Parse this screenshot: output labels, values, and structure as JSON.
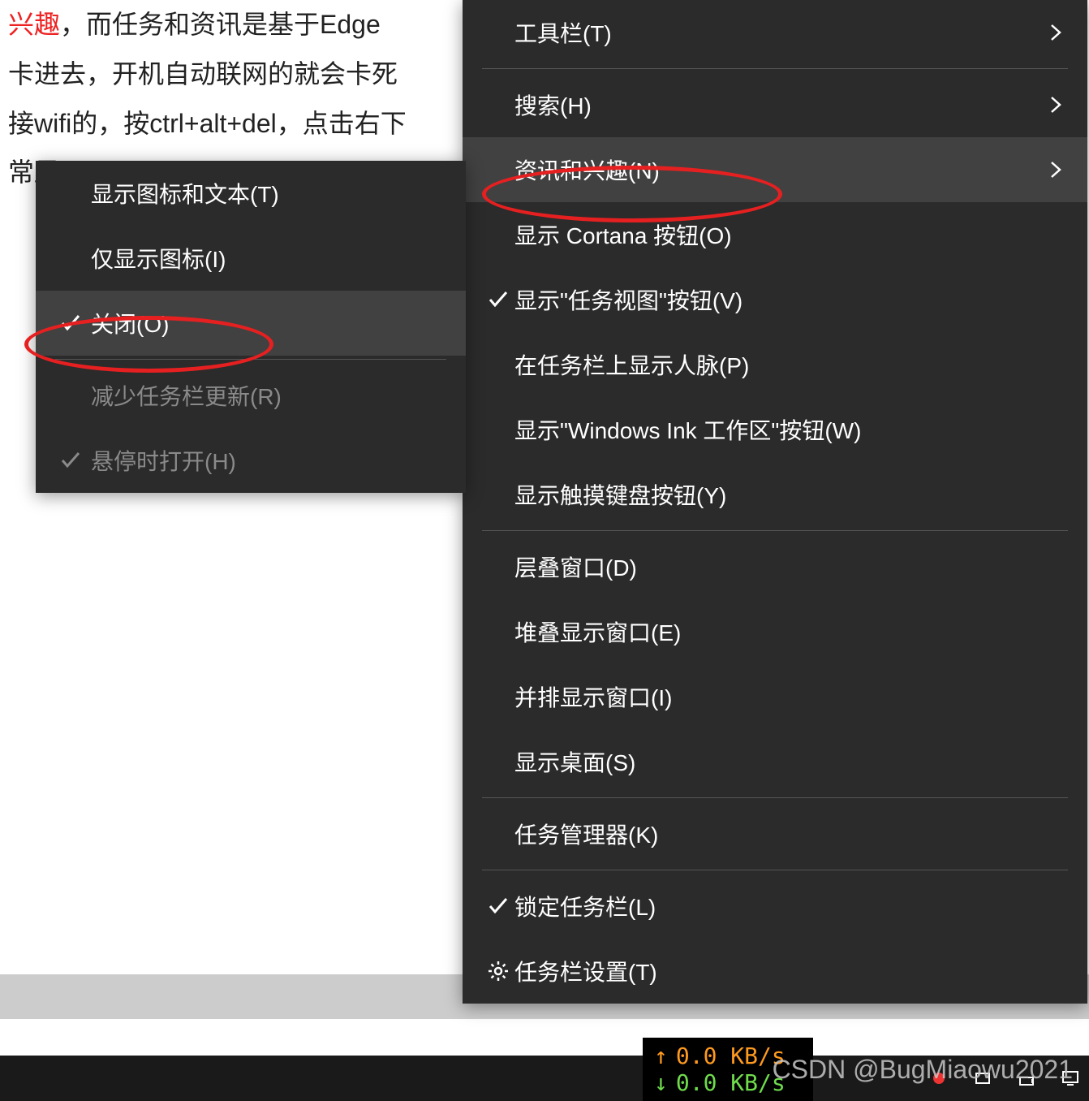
{
  "background": {
    "line1_prefix": "兴趣",
    "line1_rest": "，而任务和资讯是基于Edge",
    "line2": "卡进去，开机自动联网的就会卡死",
    "line3": "接wifi的，按ctrl+alt+del，点击右下",
    "line4": "常显"
  },
  "main_menu": {
    "items": [
      {
        "label": "工具栏(T)",
        "arrow": true
      },
      {
        "label": "搜索(H)",
        "arrow": true
      },
      {
        "label": "资讯和兴趣(N)",
        "arrow": true,
        "highlight": true
      },
      {
        "label": "显示 Cortana 按钮(O)"
      },
      {
        "label": "显示\"任务视图\"按钮(V)",
        "checked": true
      },
      {
        "label": "在任务栏上显示人脉(P)"
      },
      {
        "label": "显示\"Windows Ink 工作区\"按钮(W)"
      },
      {
        "label": "显示触摸键盘按钮(Y)"
      },
      {
        "label": "层叠窗口(D)"
      },
      {
        "label": "堆叠显示窗口(E)"
      },
      {
        "label": "并排显示窗口(I)"
      },
      {
        "label": "显示桌面(S)"
      },
      {
        "label": "任务管理器(K)"
      },
      {
        "label": "锁定任务栏(L)",
        "checked": true
      },
      {
        "label": "任务栏设置(T)",
        "gear": true
      }
    ]
  },
  "sub_menu": {
    "items": [
      {
        "label": "显示图标和文本(T)"
      },
      {
        "label": "仅显示图标(I)"
      },
      {
        "label": "关闭(O)",
        "checked": true,
        "highlight": true
      },
      {
        "label": "减少任务栏更新(R)",
        "disabled": true
      },
      {
        "label": "悬停时打开(H)",
        "disabled": true,
        "checked": true
      }
    ]
  },
  "netspeed": {
    "up": "0.0 KB/s",
    "down": "0.0 KB/s"
  },
  "watermark": "CSDN @BugMiaowu2021"
}
